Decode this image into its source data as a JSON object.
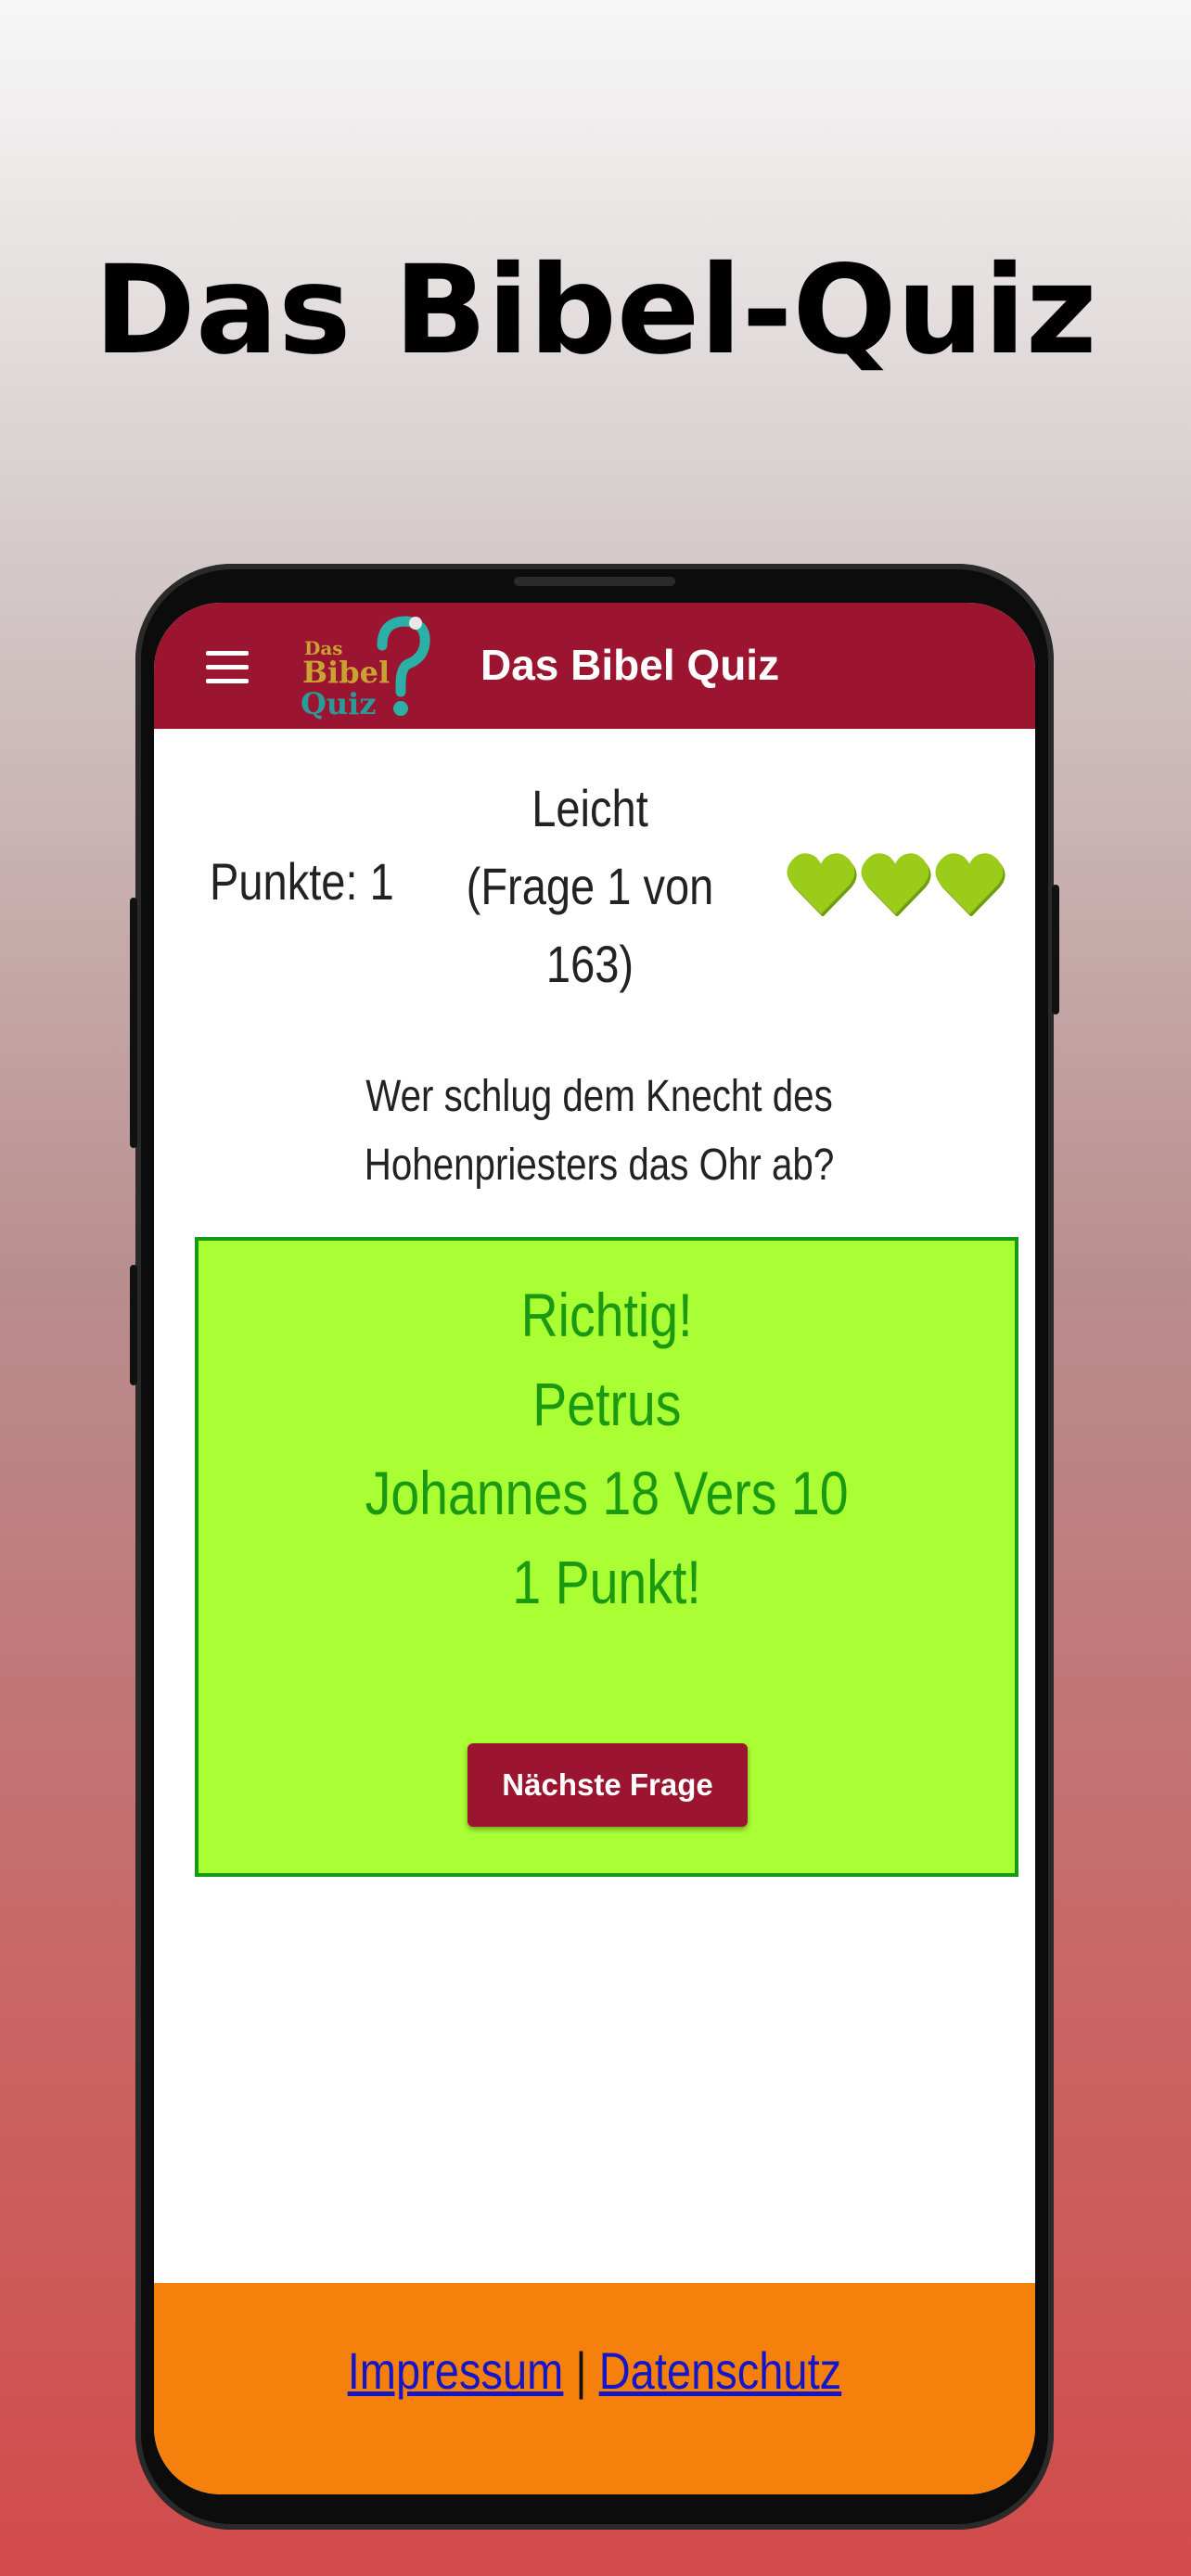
{
  "promo": {
    "title": "Das Bibel-Quiz"
  },
  "app_bar": {
    "title": "Das Bibel Quiz",
    "logo_text": [
      "Das",
      "Bibel",
      "Quiz"
    ]
  },
  "status": {
    "score_label": "Punkte: 1",
    "level": "Leicht",
    "question_progress_line1": "(Frage 1 von",
    "question_progress_line2": "163)",
    "lives": 3
  },
  "question": {
    "text": "Wer schlug dem Knecht des Hohenpriesters das Ohr ab?"
  },
  "result": {
    "verdict": "Richtig!",
    "answer": "Petrus",
    "reference": "Johannes 18 Vers 10",
    "points": "1 Punkt!",
    "next_button_label": "Nächste Frage"
  },
  "footer": {
    "impressum": "Impressum",
    "separator": "|",
    "datenschutz": "Datenschutz"
  },
  "colors": {
    "brand": "#9b1530",
    "result_bg": "#a9ff33",
    "result_text": "#1a9a10",
    "footer_bg": "#f5800b",
    "heart": "#9ccc1a"
  },
  "icons": {
    "menu": "hamburger-icon",
    "heart": "heart-icon"
  }
}
